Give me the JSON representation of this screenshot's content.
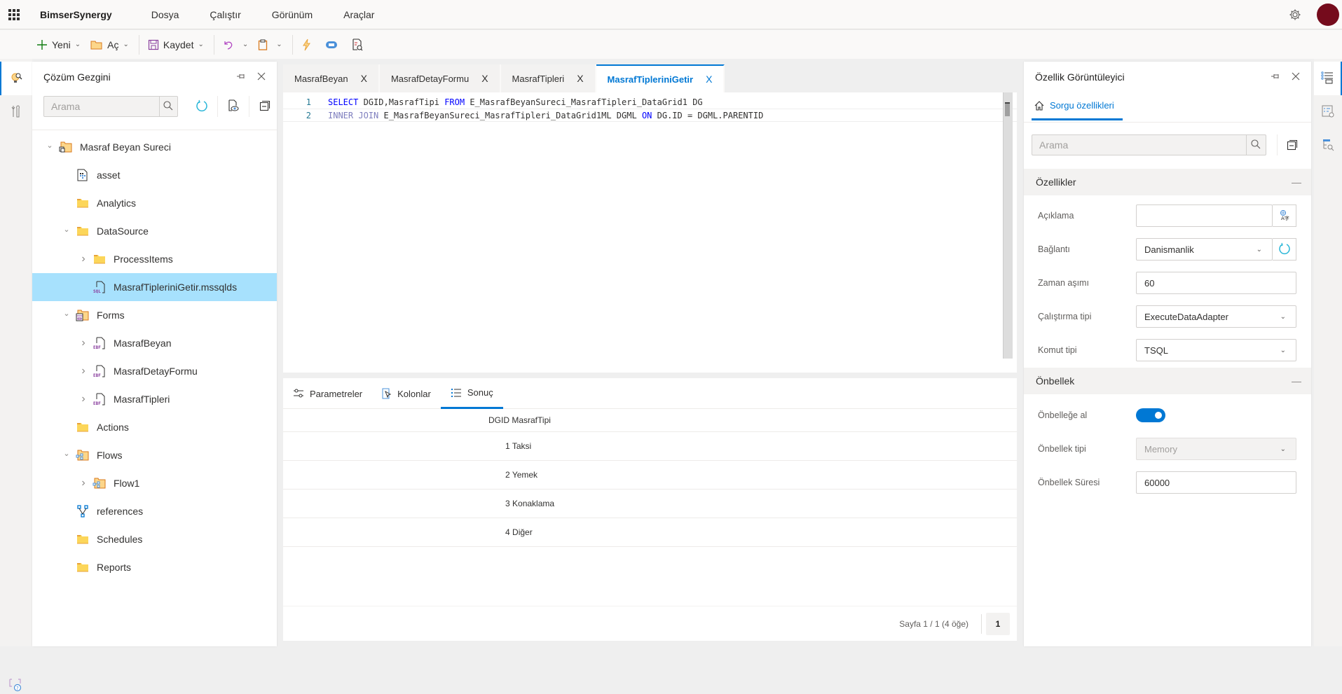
{
  "app": {
    "brand": "BimserSynergy",
    "menu": [
      "Dosya",
      "Çalıştır",
      "Görünüm",
      "Araçlar"
    ]
  },
  "toolbar": {
    "new_label": "Yeni",
    "open_label": "Aç",
    "save_label": "Kaydet"
  },
  "explorer": {
    "title": "Çözüm Gezgini",
    "search_placeholder": "Arama",
    "tree": [
      {
        "label": "Masraf Beyan Sureci",
        "icon": "project-folder-icon",
        "expander": "expanded",
        "level": 0
      },
      {
        "label": "asset",
        "icon": "asset-icon",
        "expander": "none",
        "level": 1
      },
      {
        "label": "Analytics",
        "icon": "folder-icon",
        "expander": "none",
        "level": 1
      },
      {
        "label": "DataSource",
        "icon": "folder-icon",
        "expander": "expanded",
        "level": 1
      },
      {
        "label": "ProcessItems",
        "icon": "folder-icon",
        "expander": "collapsed",
        "level": 2
      },
      {
        "label": "MasrafTipleriniGetir.mssqlds",
        "icon": "sql-file-icon",
        "expander": "none",
        "level": 2,
        "selected": true
      },
      {
        "label": "Forms",
        "icon": "forms-folder-icon",
        "expander": "expanded",
        "level": 1
      },
      {
        "label": "MasrafBeyan",
        "icon": "form-file-icon",
        "expander": "collapsed",
        "level": 2
      },
      {
        "label": "MasrafDetayFormu",
        "icon": "form-file-icon",
        "expander": "collapsed",
        "level": 2
      },
      {
        "label": "MasrafTipleri",
        "icon": "form-file-icon",
        "expander": "collapsed",
        "level": 2
      },
      {
        "label": "Actions",
        "icon": "folder-icon",
        "expander": "none",
        "level": 1
      },
      {
        "label": "Flows",
        "icon": "flows-folder-icon",
        "expander": "expanded",
        "level": 1
      },
      {
        "label": "Flow1",
        "icon": "flows-folder-icon",
        "expander": "collapsed",
        "level": 2
      },
      {
        "label": "references",
        "icon": "references-icon",
        "expander": "none",
        "level": 1
      },
      {
        "label": "Schedules",
        "icon": "folder-icon",
        "expander": "none",
        "level": 1
      },
      {
        "label": "Reports",
        "icon": "folder-icon",
        "expander": "none",
        "level": 1
      }
    ]
  },
  "editor": {
    "tabs": [
      {
        "label": "MasrafBeyan",
        "active": false
      },
      {
        "label": "MasrafDetayFormu",
        "active": false
      },
      {
        "label": "MasrafTipleri",
        "active": false
      },
      {
        "label": "MasrafTipleriniGetir",
        "active": true
      }
    ],
    "lines": [
      {
        "num": "1",
        "tokens": [
          {
            "t": "SELECT",
            "k": "kw"
          },
          {
            "t": " DGID,MasrafTipi ",
            "k": ""
          },
          {
            "t": "FROM",
            "k": "kw"
          },
          {
            "t": " E_MasrafBeyanSureci_MasrafTipleri_DataGrid1 DG",
            "k": ""
          }
        ]
      },
      {
        "num": "2",
        "tokens": [
          {
            "t": "INNER JOIN",
            "k": "kw2"
          },
          {
            "t": " E_MasrafBeyanSureci_MasrafTipleri_DataGrid1ML DGML ",
            "k": ""
          },
          {
            "t": "ON",
            "k": "kw"
          },
          {
            "t": " DG.ID = DGML.PARENTID",
            "k": ""
          }
        ]
      }
    ]
  },
  "results": {
    "tabs": [
      {
        "label": "Parametreler",
        "icon": "sliders-icon",
        "active": false
      },
      {
        "label": "Kolonlar",
        "icon": "columns-cursor-icon",
        "active": false
      },
      {
        "label": "Sonuç",
        "icon": "list-icon",
        "active": true
      }
    ],
    "columns": [
      "DGID",
      "MasrafTipi"
    ],
    "rows": [
      [
        "1",
        "Taksi"
      ],
      [
        "2",
        "Yemek"
      ],
      [
        "3",
        "Konaklama"
      ],
      [
        "4",
        "Diğer"
      ]
    ],
    "pager_info": "Sayfa 1 / 1 (4 öğe)",
    "current_page": "1"
  },
  "properties": {
    "title": "Özellik Görüntüleyici",
    "tab_label": "Sorgu özellikleri",
    "search_placeholder": "Arama",
    "section1": "Özellikler",
    "section2": "Önbellek",
    "fields": {
      "aciklama": {
        "label": "Açıklama",
        "value": ""
      },
      "baglanti": {
        "label": "Bağlantı",
        "value": "Danismanlik"
      },
      "zaman_asimi": {
        "label": "Zaman aşımı",
        "value": "60"
      },
      "calistirma_tipi": {
        "label": "Çalıştırma tipi",
        "value": "ExecuteDataAdapter"
      },
      "komut_tipi": {
        "label": "Komut tipi",
        "value": "TSQL"
      },
      "onbellege_al": {
        "label": "Önbelleğe al",
        "value": true
      },
      "onbellek_tipi": {
        "label": "Önbellek tipi",
        "value": "Memory",
        "disabled": true
      },
      "onbellek_suresi": {
        "label": "Önbellek Süresi",
        "value": "60000"
      }
    }
  },
  "colors": {
    "accent": "#0078d4",
    "selected_row": "#a7e1fd",
    "avatar": "#750b1c"
  }
}
